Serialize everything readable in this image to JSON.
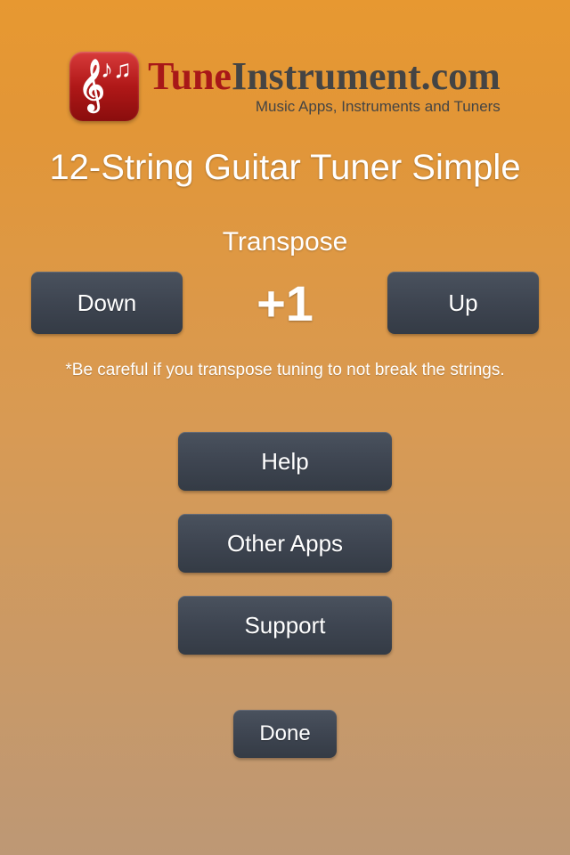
{
  "brand": {
    "name_prefix": "Tune",
    "name_suffix": "Instrument.com",
    "tagline": "Music Apps, Instruments and Tuners"
  },
  "title": "12-String Guitar Tuner Simple",
  "transpose": {
    "label": "Transpose",
    "down_label": "Down",
    "up_label": "Up",
    "value": "+1",
    "warning": "*Be careful if you transpose tuning to not break the strings."
  },
  "menu": {
    "help": "Help",
    "other_apps": "Other Apps",
    "support": "Support"
  },
  "done_label": "Done"
}
